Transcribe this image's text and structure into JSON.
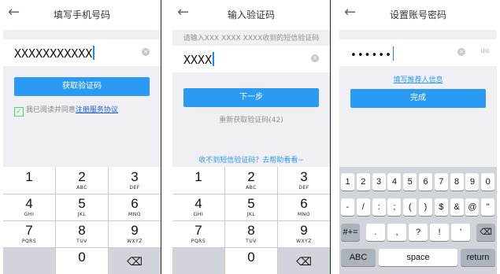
{
  "screen1": {
    "title": "填写手机号码",
    "phone_value": "XXXXXXXXXXX",
    "button": "获取验证码",
    "agree_text": "我已阅读并同意",
    "agree_link": "注册服务协议"
  },
  "screen2": {
    "title": "输入验证码",
    "hint": "请输入XXX XXXX XXXX收到的短信验证码",
    "code_value": "XXXX",
    "button": "下一步",
    "resend": "重新获取验证码(42)",
    "help": "收不到短信验证码？去帮助看看~"
  },
  "screen3": {
    "title": "设置账号密码",
    "password_mask": "••••••",
    "referrer_link": "填写推荐人信息",
    "button": "完成"
  },
  "keypad": [
    {
      "d": "1",
      "l": ""
    },
    {
      "d": "2",
      "l": "ABC"
    },
    {
      "d": "3",
      "l": "DEF"
    },
    {
      "d": "4",
      "l": "GHI"
    },
    {
      "d": "5",
      "l": "JKL"
    },
    {
      "d": "6",
      "l": "MNO"
    },
    {
      "d": "7",
      "l": "PQRS"
    },
    {
      "d": "8",
      "l": "TUV"
    },
    {
      "d": "9",
      "l": "WXYZ"
    },
    {
      "d": "",
      "l": ""
    },
    {
      "d": "0",
      "l": ""
    },
    {
      "d": "⌫",
      "l": ""
    }
  ],
  "keyboard": {
    "row1": [
      "1",
      "2",
      "3",
      "4",
      "5",
      "6",
      "7",
      "8",
      "9",
      "0"
    ],
    "row2": [
      "-",
      "/",
      ":",
      ";",
      "(",
      ")",
      "$",
      "&",
      "@",
      "\""
    ],
    "row3": [
      "#+=",
      ".",
      ",",
      "?",
      "!",
      "'",
      "⌫"
    ],
    "row4": [
      "ABC",
      "space",
      "return"
    ]
  },
  "colors": {
    "accent": "#2b9af3",
    "check": "#4cd964",
    "background": "#efeff4"
  }
}
